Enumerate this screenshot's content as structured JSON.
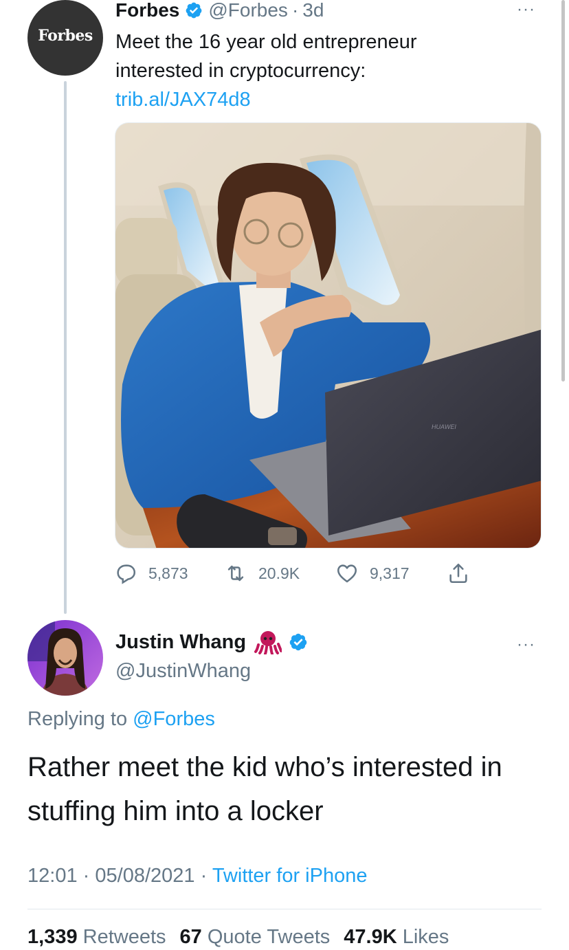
{
  "parent_tweet": {
    "avatar_text": "Forbes",
    "name": "Forbes",
    "handle": "@Forbes",
    "separator": "·",
    "time": "3d",
    "more": "···",
    "text": "Meet the 16 year old entrepreneur interested in cryptocurrency: ",
    "link": "trib.al/JAX74d8",
    "media_brand_text": "HUAWEI",
    "actions": {
      "replies": "5,873",
      "retweets": "20.9K",
      "likes": "9,317"
    }
  },
  "reply_tweet": {
    "name": "Justin Whang",
    "handle": "@JustinWhang",
    "more": "···",
    "replying_prefix": "Replying to",
    "replying_to": "@Forbes",
    "text": "Rather meet the kid who’s interested in stuffing him into a locker",
    "time": "12:01",
    "date": "05/08/2021",
    "separator": "·",
    "source": "Twitter for iPhone",
    "stats": {
      "retweets_count": "1,339",
      "retweets_label": "Retweets",
      "quotes_count": "67",
      "quotes_label": "Quote Tweets",
      "likes_count": "47.9K",
      "likes_label": "Likes"
    }
  },
  "colors": {
    "accent": "#1da1f2",
    "secondary_text": "#657786",
    "primary_text": "#14171a",
    "thread_line": "#c9d3dc"
  },
  "icons": [
    "verified-badge-icon",
    "reply-icon",
    "retweet-icon",
    "like-icon",
    "share-icon",
    "octopus-emoji-icon",
    "more-icon"
  ]
}
